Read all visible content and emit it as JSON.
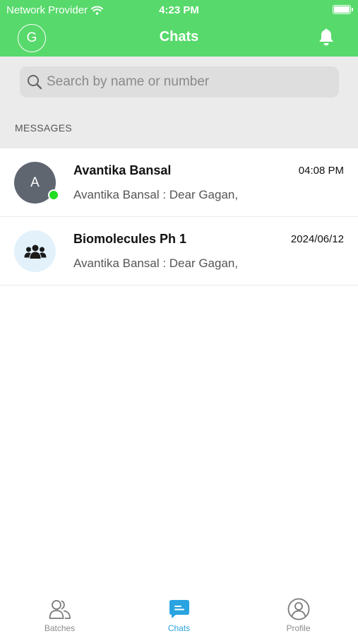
{
  "status_bar": {
    "carrier": "Network Provider",
    "time": "4:23 PM"
  },
  "header": {
    "title": "Chats",
    "account_initial": "G"
  },
  "search": {
    "placeholder": "Search by name or number"
  },
  "section": {
    "label": "MESSAGES"
  },
  "chats": [
    {
      "avatar": "A",
      "avatar_type": "person",
      "online": true,
      "name": "Avantika Bansal",
      "time": "04:08 PM",
      "preview": "Avantika Bansal : Dear Gagan,"
    },
    {
      "avatar": "group-icon",
      "avatar_type": "group",
      "online": false,
      "name": "Biomolecules Ph 1",
      "time": "2024/06/12",
      "preview": "Avantika Bansal : Dear Gagan,"
    }
  ],
  "tabs": [
    {
      "label": "Batches",
      "icon": "batches-icon",
      "active": false
    },
    {
      "label": "Chats",
      "icon": "chats-icon",
      "active": true
    },
    {
      "label": "Profile",
      "icon": "profile-icon",
      "active": false
    }
  ],
  "colors": {
    "header": "#57d96b",
    "active_tab": "#2aa4e0",
    "online": "#22dd22"
  }
}
